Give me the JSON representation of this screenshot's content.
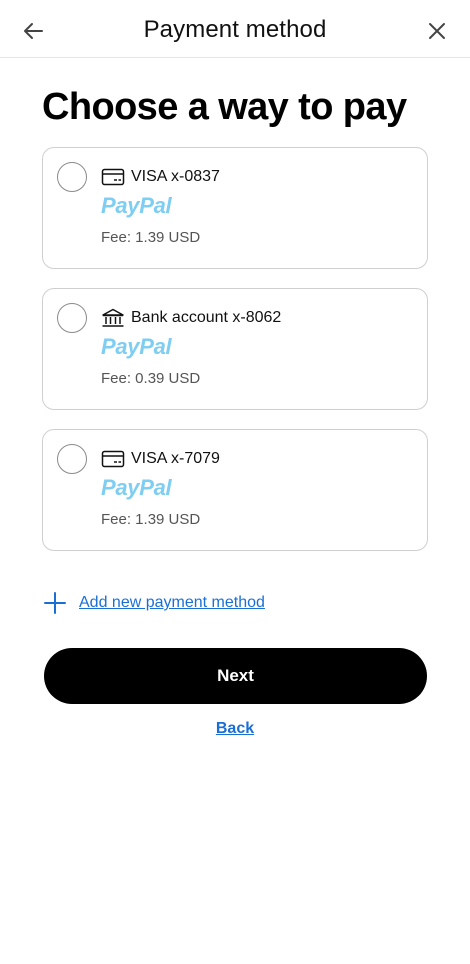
{
  "header": {
    "title": "Payment method",
    "back_icon": "arrow-left-icon",
    "close_icon": "close-icon"
  },
  "heading": "Choose a way to pay",
  "methods": [
    {
      "icon": "card-icon",
      "label": "VISA x-0837",
      "brand": "PayPal",
      "fee": "Fee: 1.39 USD"
    },
    {
      "icon": "bank-icon",
      "label": "Bank account x-8062",
      "brand": "PayPal",
      "fee": "Fee: 0.39 USD"
    },
    {
      "icon": "card-icon",
      "label": "VISA x-7079",
      "brand": "PayPal",
      "fee": "Fee: 1.39 USD"
    }
  ],
  "add_method": {
    "icon": "plus-icon",
    "label": "Add new payment method"
  },
  "next_button": "Next",
  "back_link": "Back",
  "colors": {
    "paypal": "#7ecdf2",
    "link": "#1a6fd6",
    "primary_button": "#000000"
  }
}
